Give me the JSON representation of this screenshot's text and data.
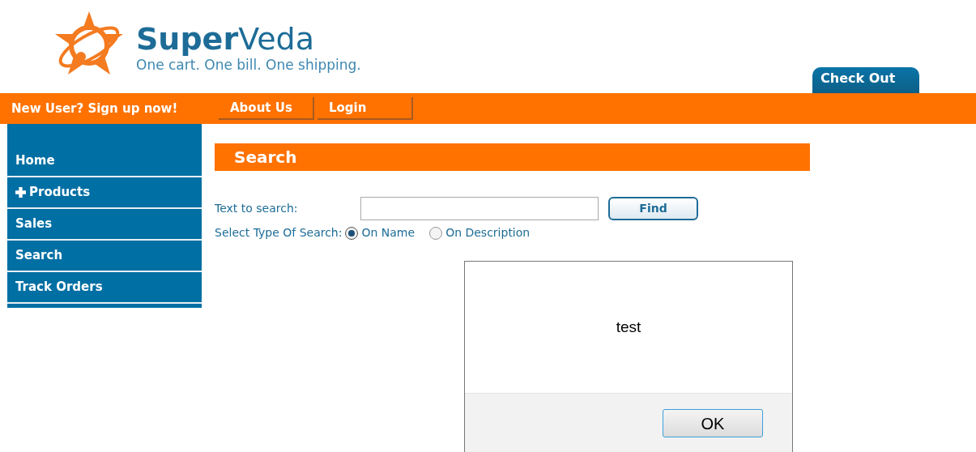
{
  "logo": {
    "name_bold": "Super",
    "name_light": "Veda",
    "tagline": "One cart. One bill. One shipping."
  },
  "checkout_tab": "Check Out",
  "top_bar": {
    "signup": "New User? Sign up now!",
    "buttons": [
      "About Us",
      "Login"
    ]
  },
  "sidebar": {
    "items": [
      {
        "label": "Home",
        "expandable": false
      },
      {
        "label": "Products",
        "expandable": true
      },
      {
        "label": "Sales",
        "expandable": false
      },
      {
        "label": "Search",
        "expandable": false
      },
      {
        "label": "Track Orders",
        "expandable": false
      }
    ]
  },
  "search": {
    "heading": "Search",
    "text_label": "Text to search:",
    "find_button": "Find",
    "type_label": "Select Type Of Search:",
    "options": [
      {
        "label": "On Name",
        "selected": true
      },
      {
        "label": "On Description",
        "selected": false
      }
    ]
  },
  "dialog": {
    "message": "test",
    "button": "OK"
  }
}
